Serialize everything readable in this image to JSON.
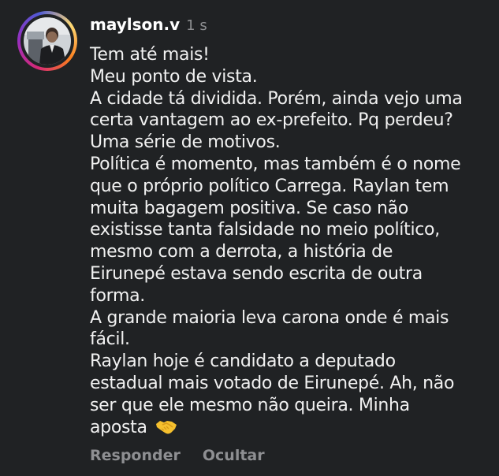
{
  "comment": {
    "avatar": {
      "alt": "avatar",
      "ring_colors": [
        "#d62976",
        "#962fbf",
        "#4f5bd5",
        "#feda75",
        "#fa7e1e"
      ]
    },
    "username": "maylson.v",
    "time": "1 s",
    "lines": [
      "Tem até mais!",
      "Meu ponto de vista.",
      "A cidade tá dividida. Porém, ainda vejo uma",
      "certa vantagem ao ex-prefeito. Pq perdeu?",
      "Uma série de motivos.",
      "Política é momento, mas também é o nome",
      "que o próprio político Carrega. Raylan tem",
      "muita bagagem positiva. Se caso não",
      "existisse tanta falsidade no meio político,",
      "mesmo com a derrota, a história de",
      "Eirunepé estava sendo escrita de outra",
      "forma.",
      "A grande maioria leva carona onde é mais",
      "fácil.",
      "Raylan hoje é candidato a deputado",
      "estadual mais votado de Eirunepé. Ah, não",
      "ser que ele mesmo não queira. Minha",
      "aposta"
    ],
    "emoji_icon": "handshake-emoji-icon",
    "actions": {
      "reply": "Responder",
      "hide": "Ocultar"
    }
  }
}
